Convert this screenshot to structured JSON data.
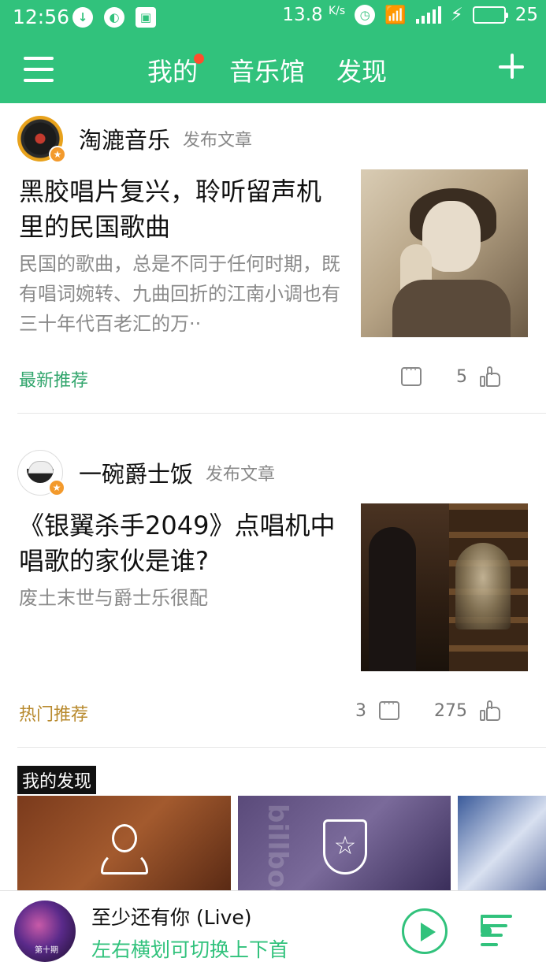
{
  "status_bar": {
    "time": "12:56",
    "speed": "13.8",
    "speed_unit": "K/s",
    "battery": "25",
    "icons": [
      "notification-icon",
      "sync-icon",
      "gallery-icon",
      "alarm-icon",
      "wifi-icon",
      "signal-icon",
      "charging-icon",
      "battery-icon"
    ]
  },
  "header": {
    "tabs": [
      {
        "label": "我的",
        "has_dot": true
      },
      {
        "label": "音乐馆",
        "has_dot": false
      },
      {
        "label": "发现",
        "has_dot": false
      }
    ],
    "accent_color": "#31c27c"
  },
  "articles": [
    {
      "author": "淘漉音乐",
      "action": "发布文章",
      "title": "黑胶唱片复兴，聆听留声机里的民国歌曲",
      "summary": "民国的歌曲，总是不同于任何时期，既有唱词婉转、九曲回折的江南小调也有三十年代百老汇的万··",
      "tag": "最新推荐",
      "comments": "",
      "likes": "5"
    },
    {
      "author": "一碗爵士饭",
      "action": "发布文章",
      "title": "《银翼杀手2049》点唱机中唱歌的家伙是谁?",
      "summary": "废土末世与爵士乐很配",
      "tag": "热门推荐",
      "comments": "3",
      "likes": "275"
    }
  ],
  "discovery": {
    "label": "我的发现",
    "cards": [
      {
        "icon": "person-icon"
      },
      {
        "icon": "shield-star-icon",
        "overlay": "billboard"
      },
      {
        "icon": ""
      }
    ]
  },
  "player": {
    "song_title": "至少还有你 (Live)",
    "hint": "左右横划可切换上下首",
    "album_text": "第十期"
  }
}
